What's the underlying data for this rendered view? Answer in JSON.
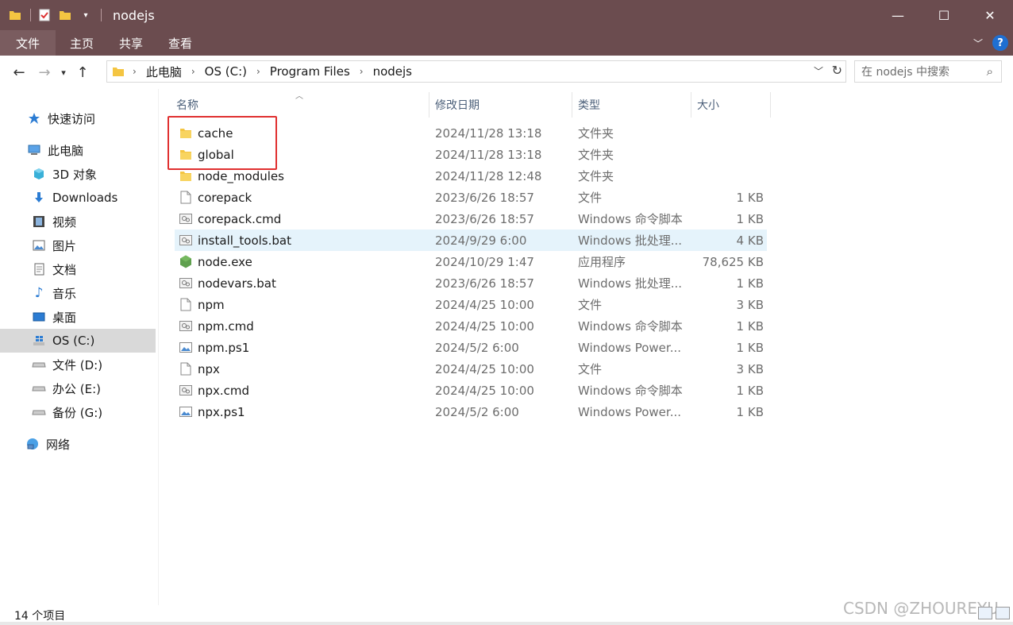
{
  "window": {
    "title": "nodejs",
    "controls": [
      "—",
      "☐",
      "✕"
    ]
  },
  "ribbon": {
    "tabs": [
      "文件",
      "主页",
      "共享",
      "查看"
    ]
  },
  "address": {
    "crumbs": [
      "此电脑",
      "OS (C:)",
      "Program Files",
      "nodejs"
    ],
    "search_placeholder": "在 nodejs 中搜索"
  },
  "sidebar": {
    "items": [
      {
        "label": "快速访问",
        "icon": "star-icon"
      },
      {
        "label": "此电脑",
        "icon": "computer-icon"
      },
      {
        "label": "3D 对象",
        "icon": "cube-icon"
      },
      {
        "label": "Downloads",
        "icon": "download-icon"
      },
      {
        "label": "视频",
        "icon": "video-icon"
      },
      {
        "label": "图片",
        "icon": "picture-icon"
      },
      {
        "label": "文档",
        "icon": "document-icon"
      },
      {
        "label": "音乐",
        "icon": "music-icon"
      },
      {
        "label": "桌面",
        "icon": "desktop-icon"
      },
      {
        "label": "OS (C:)",
        "icon": "windows-drive-icon"
      },
      {
        "label": "文件 (D:)",
        "icon": "drive-icon"
      },
      {
        "label": "办公 (E:)",
        "icon": "drive-icon"
      },
      {
        "label": "备份 (G:)",
        "icon": "drive-icon"
      },
      {
        "label": "网络",
        "icon": "network-icon"
      }
    ]
  },
  "columns": [
    "名称",
    "修改日期",
    "类型",
    "大小"
  ],
  "files": [
    {
      "name": "cache",
      "date": "2024/11/28 13:18",
      "type": "文件夹",
      "size": "",
      "icon": "folder-icon"
    },
    {
      "name": "global",
      "date": "2024/11/28 13:18",
      "type": "文件夹",
      "size": "",
      "icon": "folder-icon"
    },
    {
      "name": "node_modules",
      "date": "2024/11/28 12:48",
      "type": "文件夹",
      "size": "",
      "icon": "folder-icon"
    },
    {
      "name": "corepack",
      "date": "2023/6/26 18:57",
      "type": "文件",
      "size": "1 KB",
      "icon": "file-icon"
    },
    {
      "name": "corepack.cmd",
      "date": "2023/6/26 18:57",
      "type": "Windows 命令脚本",
      "size": "1 KB",
      "icon": "script-icon"
    },
    {
      "name": "install_tools.bat",
      "date": "2024/9/29 6:00",
      "type": "Windows 批处理...",
      "size": "4 KB",
      "icon": "script-icon"
    },
    {
      "name": "node.exe",
      "date": "2024/10/29 1:47",
      "type": "应用程序",
      "size": "78,625 KB",
      "icon": "node-icon"
    },
    {
      "name": "nodevars.bat",
      "date": "2023/6/26 18:57",
      "type": "Windows 批处理...",
      "size": "1 KB",
      "icon": "script-icon"
    },
    {
      "name": "npm",
      "date": "2024/4/25 10:00",
      "type": "文件",
      "size": "3 KB",
      "icon": "file-icon"
    },
    {
      "name": "npm.cmd",
      "date": "2024/4/25 10:00",
      "type": "Windows 命令脚本",
      "size": "1 KB",
      "icon": "script-icon"
    },
    {
      "name": "npm.ps1",
      "date": "2024/5/2 6:00",
      "type": "Windows Power...",
      "size": "1 KB",
      "icon": "powershell-icon"
    },
    {
      "name": "npx",
      "date": "2024/4/25 10:00",
      "type": "文件",
      "size": "3 KB",
      "icon": "file-icon"
    },
    {
      "name": "npx.cmd",
      "date": "2024/4/25 10:00",
      "type": "Windows 命令脚本",
      "size": "1 KB",
      "icon": "script-icon"
    },
    {
      "name": "npx.ps1",
      "date": "2024/5/2 6:00",
      "type": "Windows Power...",
      "size": "1 KB",
      "icon": "powershell-icon"
    }
  ],
  "status": {
    "count": "14 个项目",
    "watermark": "CSDN @ZHOUREYU"
  },
  "colors": {
    "titlebar": "#6b4c4f",
    "selected_row": "#e5f3fb",
    "highlight_border": "#e03030",
    "folder": "#f4c542"
  }
}
